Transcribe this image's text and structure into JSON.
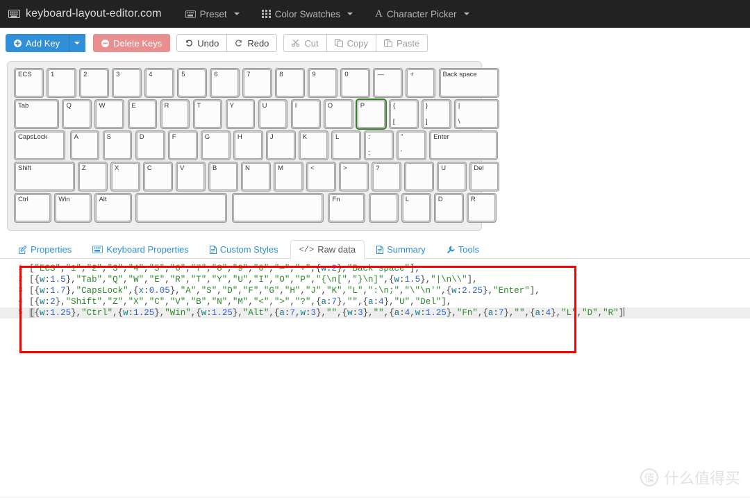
{
  "navbar": {
    "brand": "keyboard-layout-editor.com",
    "brand_icon": "keyboard-icon",
    "items": [
      {
        "label": "Preset",
        "icon": "keyboard-icon"
      },
      {
        "label": "Color Swatches",
        "icon": "grid-icon"
      },
      {
        "label": "Character Picker",
        "icon": "letter-a-icon"
      }
    ]
  },
  "toolbar": {
    "add_key": "Add Key",
    "delete_keys": "Delete Keys",
    "undo": "Undo",
    "redo": "Redo",
    "cut": "Cut",
    "copy": "Copy",
    "paste": "Paste"
  },
  "keyboard": {
    "selected_key": "P",
    "rows": [
      {
        "keys": [
          {
            "tl": "ECS",
            "x": 0,
            "w": 1
          },
          {
            "tl": "1",
            "x": 1.05,
            "w": 1
          },
          {
            "tl": "2",
            "x": 2.1,
            "w": 1
          },
          {
            "tl": "3",
            "x": 3.15,
            "w": 1
          },
          {
            "tl": "4",
            "x": 4.2,
            "w": 1
          },
          {
            "tl": "5",
            "x": 5.25,
            "w": 1
          },
          {
            "tl": "6",
            "x": 6.3,
            "w": 1
          },
          {
            "tl": "7",
            "x": 7.35,
            "w": 1
          },
          {
            "tl": "8",
            "x": 8.4,
            "w": 1
          },
          {
            "tl": "9",
            "x": 9.45,
            "w": 1
          },
          {
            "tl": "0",
            "x": 10.5,
            "w": 1
          },
          {
            "tl": "—",
            "x": 11.55,
            "w": 1
          },
          {
            "tl": "+",
            "x": 12.6,
            "w": 1
          },
          {
            "tl": "Back space",
            "x": 13.65,
            "w": 2
          }
        ]
      },
      {
        "keys": [
          {
            "tl": "Tab",
            "x": 0,
            "w": 1.5
          },
          {
            "tl": "Q",
            "x": 1.55,
            "w": 1
          },
          {
            "tl": "W",
            "x": 2.6,
            "w": 1
          },
          {
            "tl": "E",
            "x": 3.65,
            "w": 1
          },
          {
            "tl": "R",
            "x": 4.7,
            "w": 1
          },
          {
            "tl": "T",
            "x": 5.75,
            "w": 1
          },
          {
            "tl": "Y",
            "x": 6.8,
            "w": 1
          },
          {
            "tl": "U",
            "x": 7.85,
            "w": 1
          },
          {
            "tl": "I",
            "x": 8.9,
            "w": 1
          },
          {
            "tl": "O",
            "x": 9.95,
            "w": 1
          },
          {
            "tl": "P",
            "x": 11.0,
            "w": 1,
            "selected": true
          },
          {
            "tl": "{",
            "bl": "[",
            "x": 12.05,
            "w": 1
          },
          {
            "tl": "}",
            "bl": "]",
            "x": 13.1,
            "w": 1
          },
          {
            "tl": "|",
            "bl": "\\",
            "x": 14.15,
            "w": 1.5
          }
        ]
      },
      {
        "keys": [
          {
            "tl": "CapsLock",
            "x": 0,
            "w": 1.7
          },
          {
            "tl": "A",
            "x": 1.8,
            "w": 1
          },
          {
            "tl": "S",
            "x": 2.85,
            "w": 1
          },
          {
            "tl": "D",
            "x": 3.9,
            "w": 1
          },
          {
            "tl": "F",
            "x": 4.95,
            "w": 1
          },
          {
            "tl": "G",
            "x": 6.0,
            "w": 1
          },
          {
            "tl": "H",
            "x": 7.05,
            "w": 1
          },
          {
            "tl": "J",
            "x": 8.1,
            "w": 1
          },
          {
            "tl": "K",
            "x": 9.15,
            "w": 1
          },
          {
            "tl": "L",
            "x": 10.2,
            "w": 1
          },
          {
            "tl": ":",
            "bl": ";",
            "x": 11.25,
            "w": 1
          },
          {
            "tl": "\"",
            "bl": "'",
            "x": 12.3,
            "w": 1
          },
          {
            "tl": "Enter",
            "x": 13.35,
            "w": 2.25
          }
        ]
      },
      {
        "keys": [
          {
            "tl": "Shift",
            "x": 0,
            "w": 2
          },
          {
            "tl": "Z",
            "x": 2.05,
            "w": 1
          },
          {
            "tl": "X",
            "x": 3.1,
            "w": 1
          },
          {
            "tl": "C",
            "x": 4.15,
            "w": 1
          },
          {
            "tl": "V",
            "x": 5.2,
            "w": 1
          },
          {
            "tl": "B",
            "x": 6.25,
            "w": 1
          },
          {
            "tl": "N",
            "x": 7.3,
            "w": 1
          },
          {
            "tl": "M",
            "x": 8.35,
            "w": 1
          },
          {
            "tl": "<",
            "x": 9.4,
            "w": 1
          },
          {
            "tl": ">",
            "x": 10.45,
            "w": 1
          },
          {
            "tl": "?",
            "x": 11.5,
            "w": 1
          },
          {
            "tl": "",
            "x": 12.55,
            "w": 1
          },
          {
            "tl": "U",
            "x": 13.6,
            "w": 1
          },
          {
            "tl": "Del",
            "x": 14.65,
            "w": 1
          }
        ]
      },
      {
        "keys": [
          {
            "tl": "Ctrl",
            "x": 0,
            "w": 1.25
          },
          {
            "tl": "Win",
            "x": 1.3,
            "w": 1.25
          },
          {
            "tl": "Alt",
            "x": 2.6,
            "w": 1.25
          },
          {
            "tl": "",
            "x": 3.9,
            "w": 3
          },
          {
            "tl": "",
            "x": 7.0,
            "w": 3
          },
          {
            "tl": "Fn",
            "x": 10.1,
            "w": 1.25
          },
          {
            "tl": "",
            "x": 11.4,
            "w": 1
          },
          {
            "tl": "L",
            "x": 12.45,
            "w": 1
          },
          {
            "tl": "D",
            "x": 13.5,
            "w": 1
          },
          {
            "tl": "R",
            "x": 14.55,
            "w": 1
          }
        ]
      }
    ]
  },
  "tabs": [
    {
      "label": "Properties",
      "icon": "pencil-square-icon",
      "active": false
    },
    {
      "label": "Keyboard Properties",
      "icon": "keyboard-icon",
      "active": false
    },
    {
      "label": "Custom Styles",
      "icon": "file-icon",
      "active": false
    },
    {
      "label": "Raw data",
      "icon": "code-icon",
      "active": true
    },
    {
      "label": "Summary",
      "icon": "file-icon",
      "active": false
    },
    {
      "label": "Tools",
      "icon": "wrench-icon",
      "active": false
    }
  ],
  "editor": {
    "line_numbers": [
      "1",
      "2",
      "3",
      "4",
      "5"
    ],
    "lines": [
      "[\"ECS\",\"1\",\"2\",\"3\",\"4\",\"5\",\"6\",\"7\",\"8\",\"9\",\"0\",\"—\",\"+\",{w:2},\"Back space\"],",
      "[{w:1.5},\"Tab\",\"Q\",\"W\",\"E\",\"R\",\"T\",\"Y\",\"U\",\"I\",\"O\",\"P\",\"{\\n[\",\"}\\n]\",{w:1.5},\"|\\n\\\\\"],",
      "[{w:1.7},\"CapsLock\",{x:0.05},\"A\",\"S\",\"D\",\"F\",\"G\",\"H\",\"J\",\"K\",\"L\",\":\\n;\",\"\\\"\\n'\",{w:2.25},\"Enter\"],",
      "[{w:2},\"Shift\",\"Z\",\"X\",\"C\",\"V\",\"B\",\"N\",\"M\",\"<\",\">\",\"?\",{a:7},\"\",{a:4},\"U\",\"Del\"],",
      "[{w:1.25},\"Ctrl\",{w:1.25},\"Win\",{w:1.25},\"Alt\",{a:7,w:3},\"\",{w:3},\"\",{a:4,w:1.25},\"Fn\",{a:7},\"\",{a:4},\"L\",\"D\",\"R\"]"
    ],
    "active_line": 5
  },
  "annotation": {
    "color": "#ff0000"
  },
  "watermark": {
    "logo": "值",
    "text": "什么值得买"
  },
  "colors": {
    "navbar_bg": "#222222",
    "primary": "#2f8fd8",
    "danger": "#ea8f8f",
    "tab_link": "#2f8fd8",
    "key_shell": "#cccccc",
    "key_cap": "#fcfcfc",
    "selection_green": "#3a7d2c",
    "annotation_red": "#ff0000"
  }
}
